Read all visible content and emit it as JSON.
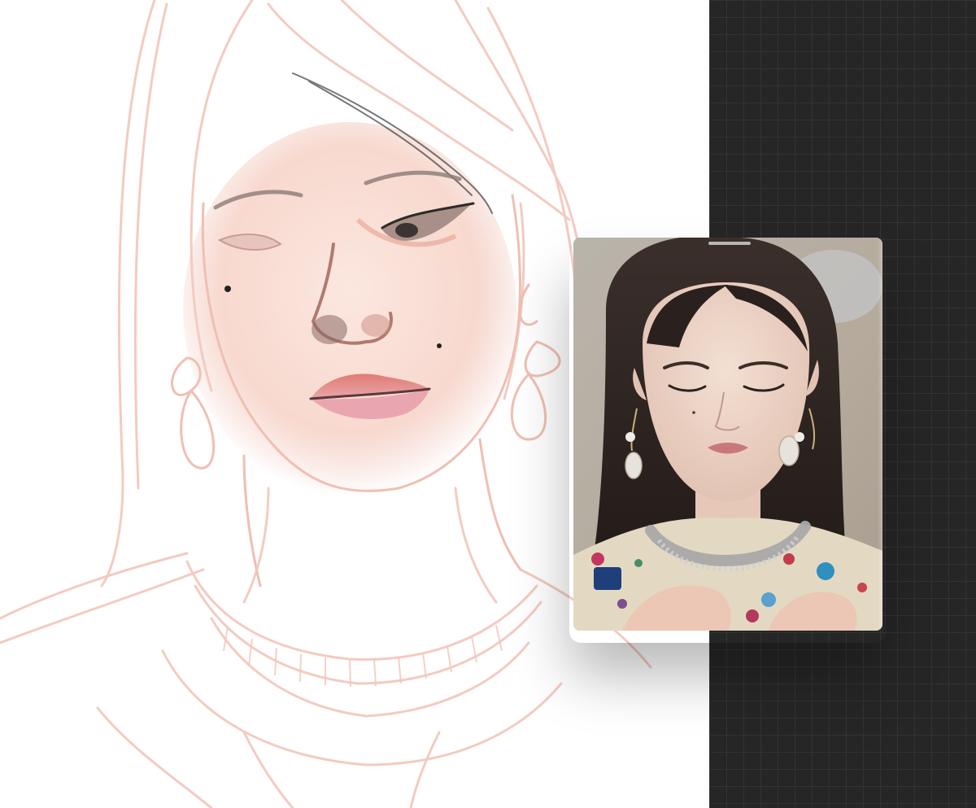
{
  "colors": {
    "canvas_background": "#ffffff",
    "grid_background": "#262626",
    "grid_lines": "#333333",
    "sketch_stroke": "#f2c6bb",
    "reference_background": "#b9b2a8"
  },
  "icons": {
    "drag_handle": "drag-handle-bar"
  }
}
